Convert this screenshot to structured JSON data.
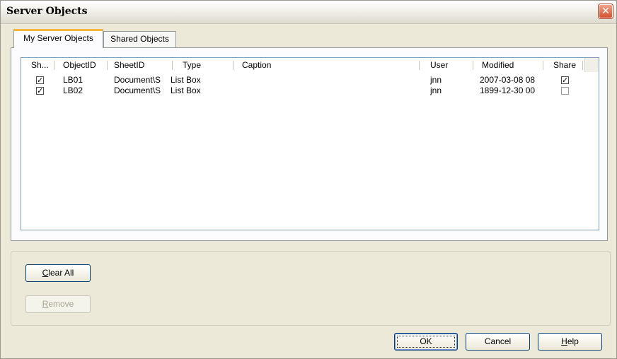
{
  "window": {
    "title": "Server Objects",
    "close_glyph": "✕"
  },
  "tabs": [
    {
      "label": "My Server Objects",
      "active": true
    },
    {
      "label": "Shared Objects",
      "active": false
    }
  ],
  "table": {
    "columns": [
      "Sh...",
      "ObjectID",
      "SheetID",
      "Type",
      "Caption",
      "User",
      "Modified",
      "Share"
    ],
    "rows": [
      {
        "show": true,
        "object_id": "LB01",
        "sheet_id": "Document\\S",
        "type": "List Box",
        "caption": "",
        "user": "jnn",
        "modified": "2007-03-08 08",
        "share": true
      },
      {
        "show": true,
        "object_id": "LB02",
        "sheet_id": "Document\\S",
        "type": "List Box",
        "caption": "",
        "user": "jnn",
        "modified": "1899-12-30 00",
        "share": false
      }
    ]
  },
  "buttons": {
    "clear_all": {
      "mnemonic": "C",
      "rest": "lear All"
    },
    "remove": {
      "mnemonic": "R",
      "rest": "emove"
    },
    "ok": "OK",
    "cancel": "Cancel",
    "help": {
      "mnemonic": "H",
      "rest": "elp"
    }
  },
  "icons": {
    "checkbox_checked": "checkmark-icon",
    "close": "close-icon"
  }
}
